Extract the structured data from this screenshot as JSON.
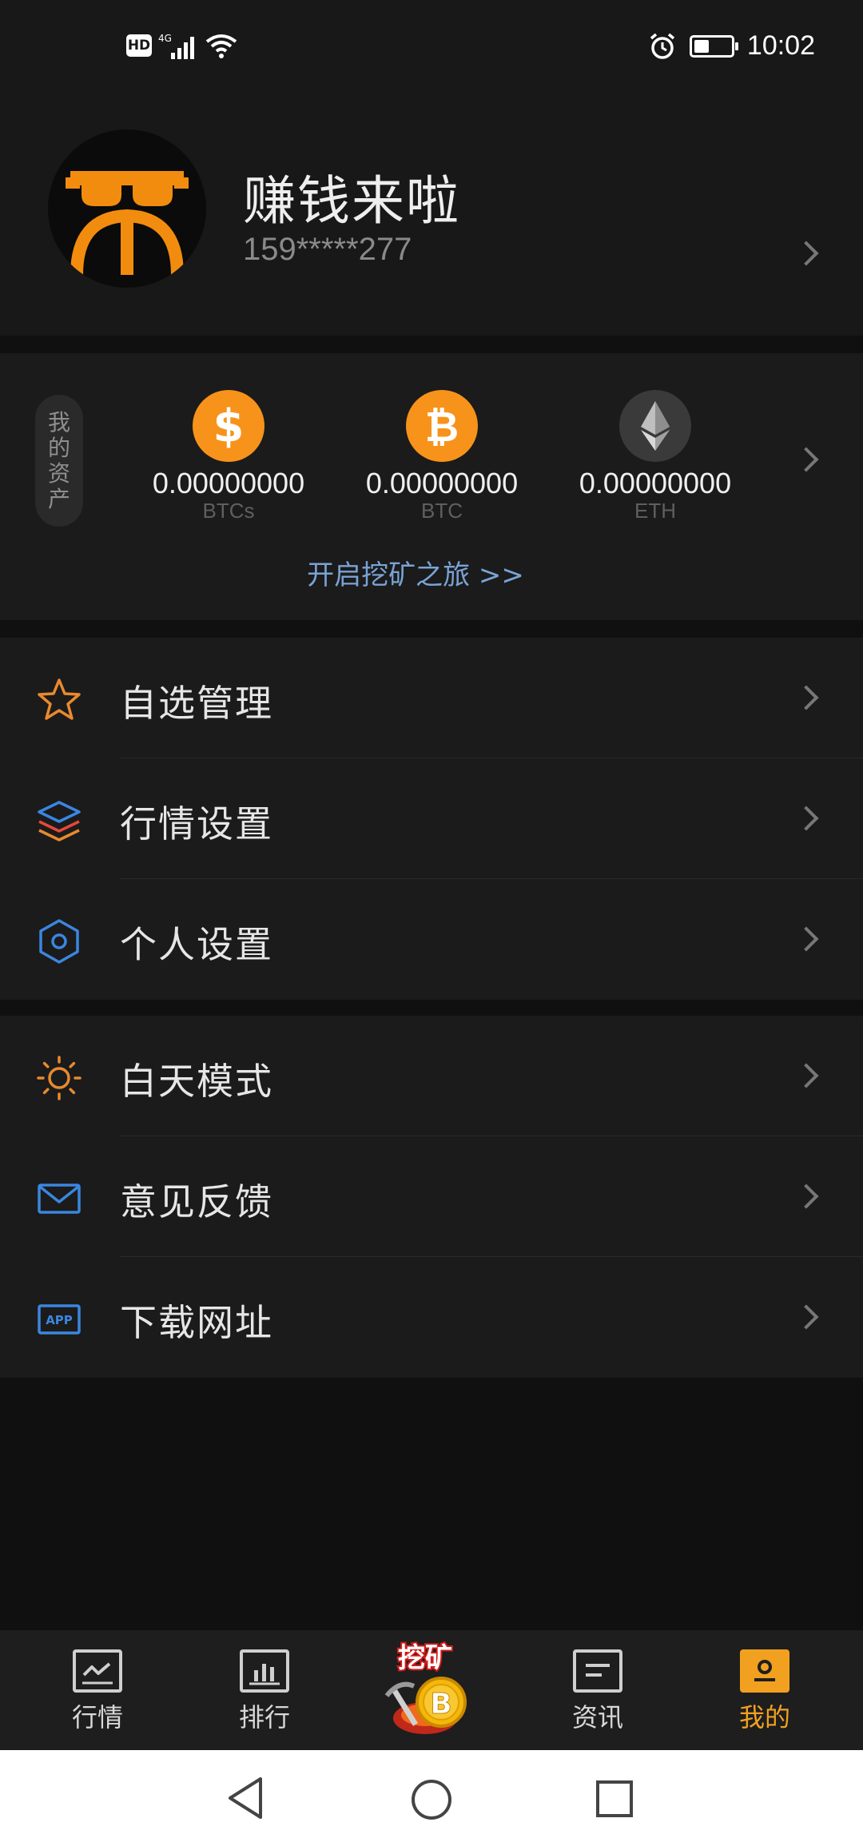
{
  "status_bar": {
    "hd": "HD",
    "network": "4G",
    "time": "10:02"
  },
  "profile": {
    "username": "赚钱来啦",
    "phone": "159*****277"
  },
  "assets": {
    "tag": "我的资产",
    "items": [
      {
        "value": "0.00000000",
        "unit": "BTCs",
        "icon": "dollar-coin-icon",
        "color": "#f7931a"
      },
      {
        "value": "0.00000000",
        "unit": "BTC",
        "icon": "bitcoin-icon",
        "color": "#f7931a"
      },
      {
        "value": "0.00000000",
        "unit": "ETH",
        "icon": "ethereum-icon",
        "color": "#3a3a3a"
      }
    ],
    "mining_link": "开启挖矿之旅 >>"
  },
  "menu_group_1": [
    {
      "label": "自选管理",
      "icon": "star-icon"
    },
    {
      "label": "行情设置",
      "icon": "layers-icon"
    },
    {
      "label": "个人设置",
      "icon": "hexagon-settings-icon"
    }
  ],
  "menu_group_2": [
    {
      "label": "白天模式",
      "icon": "sun-icon"
    },
    {
      "label": "意见反馈",
      "icon": "mail-icon"
    },
    {
      "label": "下载网址",
      "icon": "app-icon"
    }
  ],
  "bottom_nav": {
    "items": [
      {
        "label": "行情",
        "icon": "market-chart-icon"
      },
      {
        "label": "排行",
        "icon": "ranking-bars-icon"
      },
      {
        "label": "挖矿",
        "icon": "mining-bitcoin-icon"
      },
      {
        "label": "资讯",
        "icon": "news-icon"
      },
      {
        "label": "我的",
        "icon": "profile-icon",
        "active": true
      }
    ]
  },
  "colors": {
    "accent": "#f2a020",
    "link": "#7aa3d6",
    "background": "#101010",
    "card": "#1b1b1b"
  }
}
